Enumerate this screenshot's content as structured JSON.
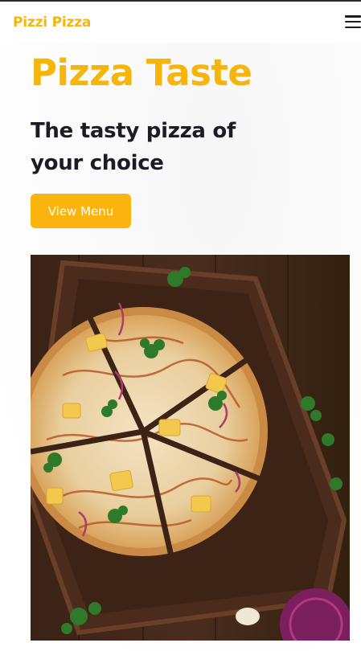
{
  "header": {
    "brand": "Pizzi Pizza",
    "menu_icon": "hamburger-menu-icon"
  },
  "hero": {
    "title": "Pizza Taste",
    "subtitle": "The tasty pizza of your choice",
    "cta_label": "View Menu"
  },
  "colors": {
    "accent": "#f5b50a",
    "button": "#fbb40d",
    "text_dark": "#1d1b26"
  }
}
